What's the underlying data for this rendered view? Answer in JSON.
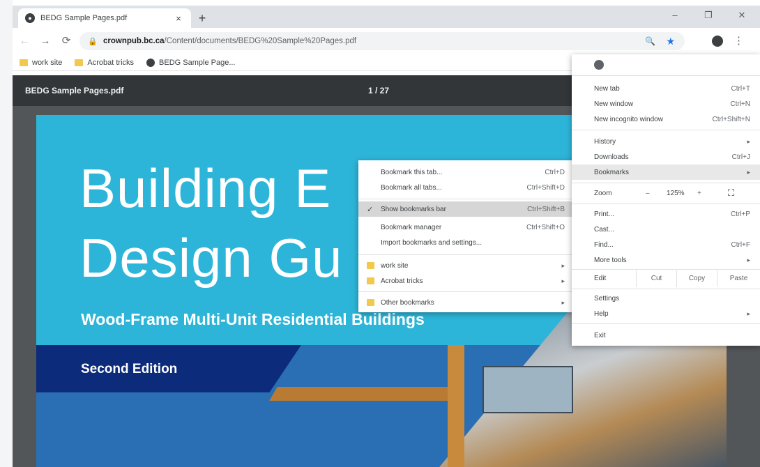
{
  "browser": {
    "tab": {
      "icon": "globe-icon",
      "title": "BEDG Sample Pages.pdf",
      "close": "×"
    },
    "new_tab": "+",
    "window_controls": {
      "minimize": "–",
      "restore": "❐",
      "close": "✕"
    },
    "nav": {
      "back": "←",
      "forward": "→",
      "reload": "⟳"
    },
    "omnibox": {
      "lock": "🔒",
      "domain": "crownpub.bc.ca",
      "path": "/Content/documents/BEDG%20Sample%20Pages.pdf",
      "zoom_icon": "🔍",
      "star_icon": "★"
    },
    "profile_icon": "●",
    "menu_icon": "⋮"
  },
  "bookmarks_bar": {
    "items": [
      {
        "label": "work site",
        "icon": "folder-icon"
      },
      {
        "label": "Acrobat tricks",
        "icon": "folder-icon"
      },
      {
        "label": "BEDG Sample Page...",
        "icon": "globe-icon"
      }
    ]
  },
  "pdf_viewer": {
    "filename": "BEDG Sample Pages.pdf",
    "page_indicator": "1 / 27"
  },
  "cover": {
    "title_line1": "Building E",
    "title_line2": "Design Gu",
    "subtitle": "Wood-Frame Multi-Unit Residential Buildings",
    "edition": "Second Edition",
    "colors": {
      "cyan": "#2cb5d8",
      "navy": "#0c2b7a",
      "blue": "#2a6fb3"
    }
  },
  "chrome_menu": {
    "items": [
      {
        "label": "New tab",
        "shortcut": "Ctrl+T"
      },
      {
        "label": "New window",
        "shortcut": "Ctrl+N"
      },
      {
        "label": "New incognito window",
        "shortcut": "Ctrl+Shift+N"
      },
      {
        "label": "History",
        "arrow": "▸"
      },
      {
        "label": "Downloads",
        "shortcut": "Ctrl+J"
      },
      {
        "label": "Bookmarks",
        "arrow": "▸"
      },
      {
        "label": "Print...",
        "shortcut": "Ctrl+P"
      },
      {
        "label": "Cast..."
      },
      {
        "label": "Find...",
        "shortcut": "Ctrl+F"
      },
      {
        "label": "More tools",
        "arrow": "▸"
      },
      {
        "label": "Settings"
      },
      {
        "label": "Help",
        "arrow": "▸"
      },
      {
        "label": "Exit"
      }
    ],
    "zoom": {
      "label": "Zoom",
      "minus": "–",
      "value": "125%",
      "plus": "+",
      "fullscreen": "⛶"
    },
    "edit": {
      "label": "Edit",
      "cut": "Cut",
      "copy": "Copy",
      "paste": "Paste"
    }
  },
  "bookmarks_menu": {
    "items": [
      {
        "label": "Bookmark this tab...",
        "shortcut": "Ctrl+D"
      },
      {
        "label": "Bookmark all tabs...",
        "shortcut": "Ctrl+Shift+D"
      },
      {
        "label": "Show bookmarks bar",
        "shortcut": "Ctrl+Shift+B",
        "check": "✓",
        "highlighted": true
      },
      {
        "label": "Bookmark manager",
        "shortcut": "Ctrl+Shift+O"
      },
      {
        "label": "Import bookmarks and settings..."
      },
      {
        "label": "work site",
        "arrow": "▸"
      },
      {
        "label": "Acrobat tricks",
        "arrow": "▸"
      },
      {
        "label": "Other bookmarks",
        "arrow": "▸"
      }
    ]
  }
}
